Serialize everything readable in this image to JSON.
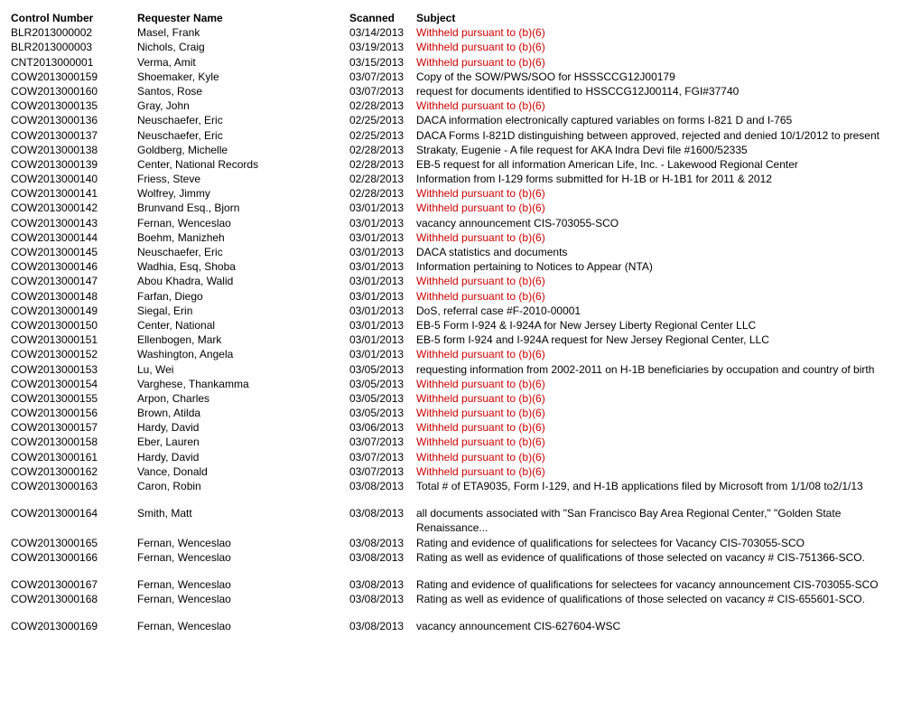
{
  "headers": {
    "control": "Control Number",
    "requester": "Requester Name",
    "scanned": "Scanned",
    "subject": "Subject"
  },
  "rows": [
    {
      "control": "BLR2013000002",
      "requester": "Masel, Frank",
      "scanned": "03/14/2013",
      "subject": "Withheld pursuant to (b)(6)",
      "withheld": true
    },
    {
      "control": "BLR2013000003",
      "requester": "Nichols, Craig",
      "scanned": "03/19/2013",
      "subject": "Withheld pursuant to (b)(6)",
      "withheld": true
    },
    {
      "control": "CNT2013000001",
      "requester": "Verma, Amit",
      "scanned": "03/15/2013",
      "subject": "Withheld pursuant to (b)(6)",
      "withheld": true
    },
    {
      "control": "COW2013000159",
      "requester": "Shoemaker, Kyle",
      "scanned": "03/07/2013",
      "subject": "Copy of the SOW/PWS/SOO for HSSSCCG12J00179",
      "withheld": false
    },
    {
      "control": "COW2013000160",
      "requester": "Santos, Rose",
      "scanned": "03/07/2013",
      "subject": "request for documents identified to HSSCCG12J00114, FGI#37740",
      "withheld": false
    },
    {
      "control": "COW2013000135",
      "requester": "Gray, John",
      "scanned": "02/28/2013",
      "subject": "Withheld pursuant to (b)(6)",
      "withheld": true
    },
    {
      "control": "COW2013000136",
      "requester": "Neuschaefer, Eric",
      "scanned": "02/25/2013",
      "subject": "DACA information electronically captured variables on forms I-821 D and I-765",
      "withheld": false
    },
    {
      "control": "COW2013000137",
      "requester": "Neuschaefer, Eric",
      "scanned": "02/25/2013",
      "subject": "DACA Forms I-821D  distinguishing between approved, rejected and denied 10/1/2012 to present",
      "withheld": false
    },
    {
      "control": "COW2013000138",
      "requester": "Goldberg, Michelle",
      "scanned": "02/28/2013",
      "subject": "Strakaty, Eugenie - A file request for AKA Indra Devi file #1600/52335",
      "withheld": false
    },
    {
      "control": "COW2013000139",
      "requester": "Center, National Records",
      "scanned": "02/28/2013",
      "subject": "EB-5 request for all information American Life, Inc. - Lakewood Regional Center",
      "withheld": false
    },
    {
      "control": "COW2013000140",
      "requester": "Friess, Steve",
      "scanned": "02/28/2013",
      "subject": "Information from I-129 forms submitted for H-1B  or H-1B1 for 2011 & 2012",
      "withheld": false
    },
    {
      "control": "COW2013000141",
      "requester": "Wolfrey, Jimmy",
      "scanned": "02/28/2013",
      "subject": "Withheld pursuant to (b)(6)",
      "withheld": true
    },
    {
      "control": "COW2013000142",
      "requester": "Brunvand Esq., Bjorn",
      "scanned": "03/01/2013",
      "subject": "Withheld pursuant to (b)(6)",
      "withheld": true
    },
    {
      "control": "COW2013000143",
      "requester": "Fernan, Wenceslao",
      "scanned": "03/01/2013",
      "subject": "vacancy announcement CIS-703055-SCO",
      "withheld": false
    },
    {
      "control": "COW2013000144",
      "requester": "Boehm, Manizheh",
      "scanned": "03/01/2013",
      "subject": "Withheld pursuant to (b)(6)",
      "withheld": true
    },
    {
      "control": "COW2013000145",
      "requester": "Neuschaefer, Eric",
      "scanned": "03/01/2013",
      "subject": "DACA statistics and documents",
      "withheld": false
    },
    {
      "control": "COW2013000146",
      "requester": "Wadhia, Esq, Shoba",
      "scanned": "03/01/2013",
      "subject": "Information pertaining to Notices to Appear (NTA)",
      "withheld": false
    },
    {
      "control": "COW2013000147",
      "requester": "Abou Khadra, Walid",
      "scanned": "03/01/2013",
      "subject": "Withheld pursuant to (b)(6)",
      "withheld": true
    },
    {
      "control": "COW2013000148",
      "requester": "Farfan, Diego",
      "scanned": "03/01/2013",
      "subject": "Withheld pursuant to (b)(6)",
      "withheld": true
    },
    {
      "control": "COW2013000149",
      "requester": "Siegal, Erin",
      "scanned": "03/01/2013",
      "subject": "DoS, referral case #F-2010-00001",
      "withheld": false
    },
    {
      "control": "COW2013000150",
      "requester": "Center, National",
      "scanned": "03/01/2013",
      "subject": "EB-5 Form I-924 & I-924A for New Jersey Liberty Regional Center LLC",
      "withheld": false
    },
    {
      "control": "COW2013000151",
      "requester": "Ellenbogen, Mark",
      "scanned": "03/01/2013",
      "subject": "EB-5 form I-924 and I-924A request for New Jersey Regional Center, LLC",
      "withheld": false
    },
    {
      "control": "COW2013000152",
      "requester": "Washington, Angela",
      "scanned": "03/01/2013",
      "subject": "Withheld pursuant to (b)(6)",
      "withheld": true
    },
    {
      "control": "COW2013000153",
      "requester": "Lu, Wei",
      "scanned": "03/05/2013",
      "subject": "requesting information from 2002-2011 on H-1B beneficiaries by occupation and country of birth",
      "withheld": false
    },
    {
      "control": "COW2013000154",
      "requester": "Varghese, Thankamma",
      "scanned": "03/05/2013",
      "subject": "Withheld pursuant to (b)(6)",
      "withheld": true
    },
    {
      "control": "COW2013000155",
      "requester": "Arpon, Charles",
      "scanned": "03/05/2013",
      "subject": "Withheld pursuant to (b)(6)",
      "withheld": true
    },
    {
      "control": "COW2013000156",
      "requester": "Brown, Atilda",
      "scanned": "03/05/2013",
      "subject": "Withheld pursuant to (b)(6)",
      "withheld": true
    },
    {
      "control": "COW2013000157",
      "requester": "Hardy, David",
      "scanned": "03/06/2013",
      "subject": "Withheld pursuant to (b)(6)",
      "withheld": true
    },
    {
      "control": "COW2013000158",
      "requester": "Eber, Lauren",
      "scanned": "03/07/2013",
      "subject": "Withheld pursuant to (b)(6)",
      "withheld": true
    },
    {
      "control": "COW2013000161",
      "requester": "Hardy, David",
      "scanned": "03/07/2013",
      "subject": "Withheld pursuant to (b)(6)",
      "withheld": true
    },
    {
      "control": "COW2013000162",
      "requester": "Vance, Donald",
      "scanned": "03/07/2013",
      "subject": "Withheld pursuant to (b)(6)",
      "withheld": true
    },
    {
      "control": "COW2013000163",
      "requester": "Caron, Robin",
      "scanned": "03/08/2013",
      "subject": "Total # of ETA9035, Form I-129, and H-1B applications filed by Microsoft from 1/1/08 to2/1/13",
      "withheld": false,
      "gap": true
    },
    {
      "control": "COW2013000164",
      "requester": "Smith, Matt",
      "scanned": "03/08/2013",
      "subject": "all documents associated with \"San Francisco Bay Area Regional Center,\" \"Golden State Renaissance...",
      "withheld": false
    },
    {
      "control": "COW2013000165",
      "requester": "Fernan, Wenceslao",
      "scanned": "03/08/2013",
      "subject": "Rating and evidence of qualifications for selectees for Vacancy CIS-703055-SCO",
      "withheld": false
    },
    {
      "control": "COW2013000166",
      "requester": "Fernan, Wenceslao",
      "scanned": "03/08/2013",
      "subject": "Rating as well as evidence of qualifications of those selected on vacancy # CIS-751366-SCO.",
      "withheld": false,
      "gap": true
    },
    {
      "control": "COW2013000167",
      "requester": "Fernan, Wenceslao",
      "scanned": "03/08/2013",
      "subject": "Rating and evidence of qualifications for selectees for vacancy announcement CIS-703055-SCO",
      "withheld": false
    },
    {
      "control": "COW2013000168",
      "requester": "Fernan, Wenceslao",
      "scanned": "03/08/2013",
      "subject": "Rating as well as evidence of qualifications of those selected on vacancy # CIS-655601-SCO.",
      "withheld": false,
      "gap": true
    },
    {
      "control": "COW2013000169",
      "requester": "Fernan, Wenceslao",
      "scanned": "03/08/2013",
      "subject": "vacancy announcement CIS-627604-WSC",
      "withheld": false
    }
  ]
}
